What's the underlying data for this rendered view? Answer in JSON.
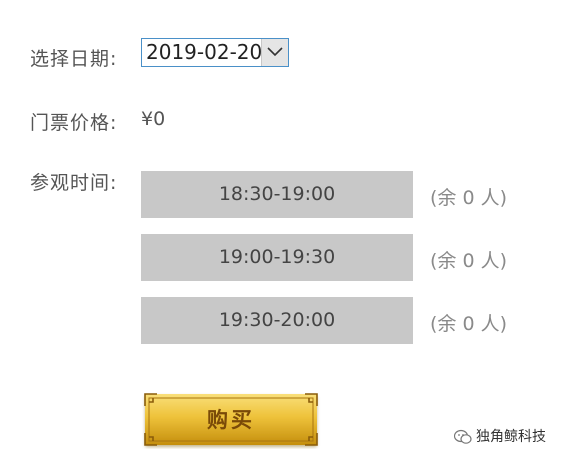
{
  "form": {
    "date_label": "选择日期:",
    "date_value": "2019-02-20",
    "price_label": "门票价格:",
    "price_value": "¥0",
    "time_label": "参观时间:"
  },
  "slots": [
    {
      "time": "18:30-19:00",
      "remaining": "(余 0 人)"
    },
    {
      "time": "19:00-19:30",
      "remaining": "(余 0 人)"
    },
    {
      "time": "19:30-20:00",
      "remaining": "(余 0 人)"
    }
  ],
  "buy_button": {
    "label": "购买"
  },
  "watermark": {
    "text": "独角鲸科技"
  },
  "colors": {
    "slot_bg": "#c8c8c8",
    "button_gold": "#e4b022",
    "select_border": "#4a90c8"
  },
  "icons": {
    "select_arrow": "chevron-down-icon",
    "watermark_logo": "wechat-icon"
  }
}
